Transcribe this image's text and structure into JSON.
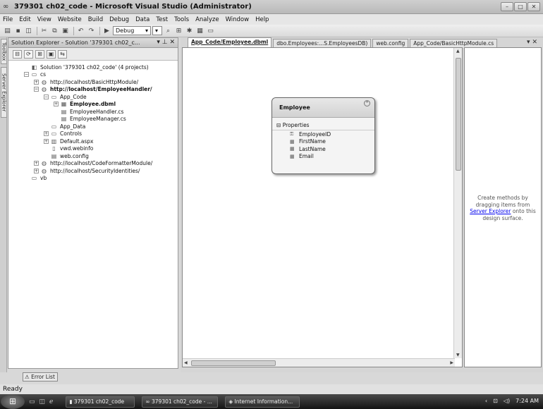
{
  "window": {
    "title": "379301 ch02_code - Microsoft Visual Studio (Administrator)"
  },
  "menu": [
    "File",
    "Edit",
    "View",
    "Website",
    "Build",
    "Debug",
    "Data",
    "Test",
    "Tools",
    "Analyze",
    "Window",
    "Help"
  ],
  "toolbar": {
    "config": "Debug"
  },
  "left_strip": {
    "toolbox": "Toolbox",
    "server_explorer": "Server Explorer"
  },
  "solution_explorer": {
    "title": "Solution Explorer - Solution '379301 ch02_c...",
    "tree": [
      {
        "label": "Solution '379301 ch02_code' (4 projects)",
        "icon": "solution-icon"
      },
      {
        "label": "cs",
        "icon": "folder-icon"
      },
      {
        "label": "http://localhost/BasicHttpModule/",
        "icon": "website-icon"
      },
      {
        "label": "http://localhost/EmployeeHandler/",
        "icon": "website-icon"
      },
      {
        "label": "App_Code",
        "icon": "folder-icon"
      },
      {
        "label": "Employee.dbml",
        "icon": "dbml-icon"
      },
      {
        "label": "EmployeeHandler.cs",
        "icon": "cs-file-icon"
      },
      {
        "label": "EmployeeManager.cs",
        "icon": "cs-file-icon"
      },
      {
        "label": "App_Data",
        "icon": "folder-icon"
      },
      {
        "label": "Controls",
        "icon": "folder-icon"
      },
      {
        "label": "Default.aspx",
        "icon": "aspx-file-icon"
      },
      {
        "label": "vwd.webinfo",
        "icon": "file-icon"
      },
      {
        "label": "web.config",
        "icon": "config-file-icon"
      },
      {
        "label": "http://localhost/CodeFormatterModule/",
        "icon": "website-icon"
      },
      {
        "label": "http://localhost/SecurityIdentities/",
        "icon": "website-icon"
      },
      {
        "label": "vb",
        "icon": "folder-icon"
      }
    ]
  },
  "tabs": [
    "App_Code/Employee.dbml",
    "dbo.Employees:...S.EmployeesDB)",
    "web.config",
    "App_Code/BasicHttpModule.cs"
  ],
  "entity": {
    "name": "Employee",
    "section": "Properties",
    "properties": [
      "EmployeeID",
      "FirstName",
      "LastName",
      "Email"
    ]
  },
  "methods_pane": {
    "line1": "Create methods by",
    "line2": "dragging items from",
    "link": "Server Explorer",
    "line3_tail": " onto this",
    "line4": "design surface."
  },
  "bottom": {
    "error_list": "Error List",
    "status": "Ready"
  },
  "taskbar": {
    "tasks": [
      "379301 ch02_code",
      "379301 ch02_code - ...",
      "Internet Information..."
    ],
    "clock": "7:24 AM"
  }
}
